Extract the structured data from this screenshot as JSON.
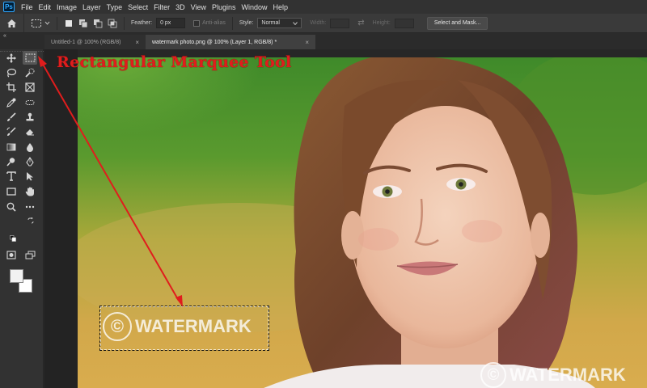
{
  "app": {
    "logo": "Ps"
  },
  "menu": [
    "File",
    "Edit",
    "Image",
    "Layer",
    "Type",
    "Select",
    "Filter",
    "3D",
    "View",
    "Plugins",
    "Window",
    "Help"
  ],
  "options": {
    "feather_label": "Feather:",
    "feather_value": "0 px",
    "antialias_label": "Anti-alias",
    "style_label": "Style:",
    "style_value": "Normal",
    "width_label": "Width:",
    "height_label": "Height:",
    "select_mask_label": "Select and Mask..."
  },
  "tabs": [
    {
      "label": "Untitled-1 @ 100% (RGB/8)",
      "close": "×",
      "active": false
    },
    {
      "label": "watermark photo.png @ 100% (Layer 1, RGB/8) *",
      "close": "×",
      "active": true
    }
  ],
  "annotation": {
    "label": "Rectangular Marquee Tool",
    "color": "#e01d1d"
  },
  "watermarks": {
    "selected_symbol": "©",
    "selected_text": "WATERMARK",
    "corner_symbol": "©",
    "corner_text": "WATERMARK"
  },
  "toolbar": {
    "collapse": "«",
    "foreground_color": "#f2f2f2",
    "background_color": "#ffffff"
  }
}
